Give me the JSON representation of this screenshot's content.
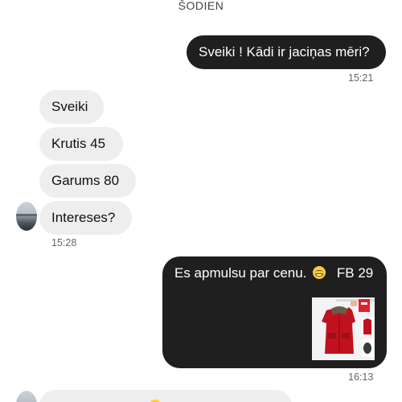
{
  "date_separator": "ŠODIEN",
  "messages": {
    "out_1": {
      "text": "Sveiki ! Kādi ir jaciņas mēri?",
      "time": "15:21"
    },
    "in_1": "Sveiki",
    "in_2": "Krutis 45",
    "in_3": "Garums 80",
    "in_4": "Intereses?",
    "in_group_time": "15:28",
    "out_2": {
      "text_before_emoji": "Es apmulsu par cenu.",
      "emoji": "grinning-sweat-emoji",
      "text_after_emoji": "FB 29",
      "image": "red-jacket-product-photo",
      "time": "16:13"
    }
  },
  "colors": {
    "outgoing_bubble": "#1f1f1f",
    "incoming_bubble": "#eeeeee",
    "jacket_red": "#c0121e"
  }
}
